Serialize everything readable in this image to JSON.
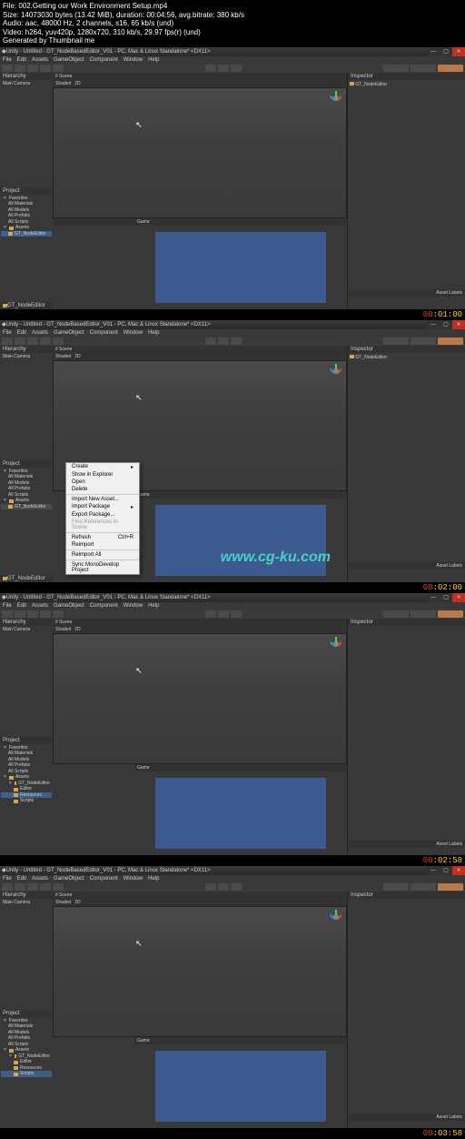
{
  "info": {
    "file": "File: 002.Getting our Work Environment Setup.mp4",
    "size": "Size: 14073030 bytes (13.42 MiB), duration: 00:04:56, avg.bitrate: 380 kb/s",
    "audio": "Audio: aac, 48000 Hz, 2 channels, s16, 65 kb/s (und)",
    "video": "Video: h264, yuv420p, 1280x720, 310 kb/s, 29.97 fps(r) (und)",
    "gen": "Generated by Thumbnail me"
  },
  "title": "Unity - Untitled - GT_NodeBasedEditor_V01 - PC, Mac & Linux Standalone* <DX11>",
  "menu": [
    "File",
    "Edit",
    "Assets",
    "GameObject",
    "Component",
    "Window",
    "Help"
  ],
  "tabs": {
    "hierarchy": "Hierarchy",
    "scene": "# Scene",
    "game": "Game",
    "inspector": "Inspector",
    "project": "Project"
  },
  "hierarchy": {
    "camera": "Main Camera"
  },
  "scene_bar": [
    "Shaded",
    "2D"
  ],
  "project": {
    "favorites": "Favorites",
    "fav_items": [
      "All Materials",
      "All Models",
      "All Prefabs",
      "All Scripts"
    ],
    "assets": "Assets",
    "asset_items": [
      "GT_NodeEditor"
    ],
    "sub_items": [
      "Editor",
      "Resources",
      "Scripts"
    ],
    "bottom": "GT_NodeEditor"
  },
  "inspector_text": "GT_NodeEditor",
  "asset_labels": "Asset Labels",
  "timestamps": [
    "00:01:00",
    "00:02:00",
    "00:02:58",
    "00:03:58"
  ],
  "ctx": {
    "create": "Create",
    "show": "Show in Explorer",
    "open": "Open",
    "delete": "Delete",
    "import": "Import New Asset...",
    "import_pkg": "Import Package",
    "export_pkg": "Export Package...",
    "find_ref": "Find References In Scene",
    "refresh": "Refresh",
    "refresh_key": "Ctrl+R",
    "reimport": "Reimport",
    "reimport_all": "Reimport All",
    "sync": "Sync MonoDevelop Project"
  },
  "watermark": "www.cg-ku.com"
}
